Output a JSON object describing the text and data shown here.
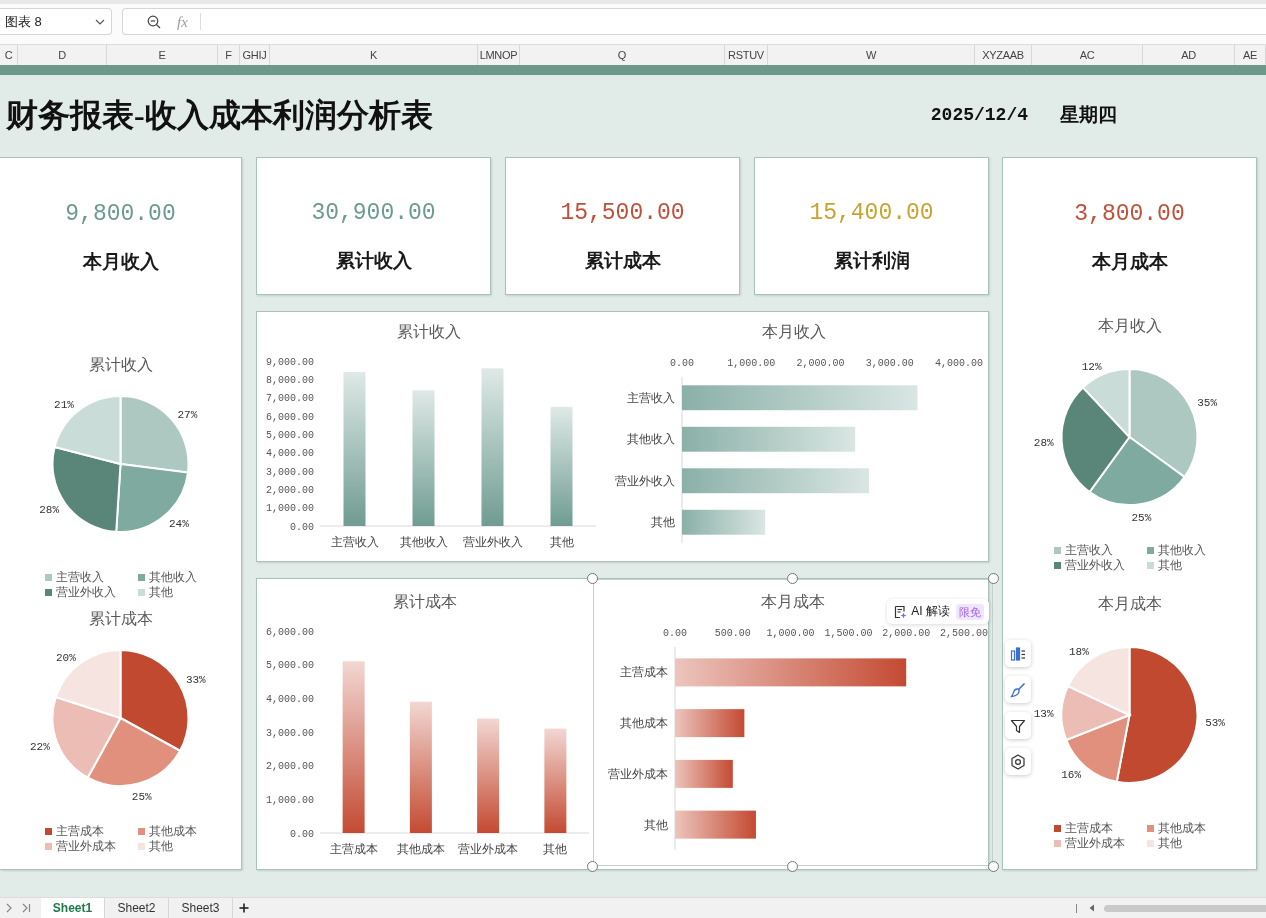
{
  "formula_bar": {
    "name_box": "图表 8",
    "function_label": "fx"
  },
  "column_headers": [
    "C",
    "D",
    "E",
    "F",
    "GHIJ",
    "K",
    "LMNOP",
    "Q",
    "RSTUV",
    "W",
    "XYZAAB",
    "AC",
    "AD",
    "AE"
  ],
  "header": {
    "title": "财务报表-收入成本利润分析表",
    "date": "2025/12/4",
    "weekday": "星期四"
  },
  "left_panel": {
    "kpi": {
      "value": "9,800.00",
      "label": "本月收入",
      "color": "#6b9a8e"
    },
    "charts": [
      {
        "selected": false,
        "chart_data": {
          "type": "pie",
          "title": "累计收入",
          "categories": [
            "主营收入",
            "其他收入",
            "营业外收入",
            "其他"
          ],
          "values": [
            27,
            24,
            28,
            21
          ],
          "colors": [
            "#adc8c1",
            "#7faa9f",
            "#5a8679",
            "#c9dcd7"
          ],
          "data_labels": true,
          "value_labels": [
            "27%",
            "24%",
            "28%",
            "21%"
          ],
          "legend": "bottom"
        }
      },
      {
        "selected": false,
        "chart_data": {
          "type": "pie",
          "title": "累计成本",
          "categories": [
            "主营成本",
            "其他成本",
            "营业外成本",
            "其他"
          ],
          "values": [
            33,
            25,
            22,
            20
          ],
          "colors": [
            "#c0492f",
            "#e0907c",
            "#ecbdb5",
            "#f6e4e1"
          ],
          "data_labels": true,
          "value_labels": [
            "33%",
            "25%",
            "22%",
            "20%"
          ],
          "legend": "bottom"
        }
      }
    ]
  },
  "kpi_cards": [
    {
      "value": "30,900.00",
      "label": "累计收入",
      "color": "#6b9a8e"
    },
    {
      "value": "15,500.00",
      "label": "累计成本",
      "color": "#c0503a"
    },
    {
      "value": "15,400.00",
      "label": "累计利润",
      "color": "#c9a330"
    }
  ],
  "chart_panels": [
    {
      "charts": [
        {
          "selected": false,
          "chart_data": {
            "type": "bar",
            "title": "累计收入",
            "categories": [
              "主营收入",
              "其他收入",
              "营业外收入",
              "其他"
            ],
            "values": [
              8400,
              7400,
              8600,
              6500
            ],
            "color": "#6f9c91",
            "ylim": [
              0,
              9000
            ],
            "yticks": [
              {
                "value": 0,
                "label": "0.00"
              },
              {
                "value": 1000,
                "label": "1,000.00"
              },
              {
                "value": 2000,
                "label": "2,000.00"
              },
              {
                "value": 3000,
                "label": "3,000.00"
              },
              {
                "value": 4000,
                "label": "4,000.00"
              },
              {
                "value": 5000,
                "label": "5,000.00"
              },
              {
                "value": 6000,
                "label": "6,000.00"
              },
              {
                "value": 7000,
                "label": "7,000.00"
              },
              {
                "value": 8000,
                "label": "8,000.00"
              },
              {
                "value": 9000,
                "label": "9,000.00"
              }
            ]
          }
        },
        {
          "selected": false,
          "chart_data": {
            "type": "bar",
            "orientation": "horizontal",
            "title": "本月收入",
            "categories": [
              "主营收入",
              "其他收入",
              "营业外收入",
              "其他"
            ],
            "values": [
              3400,
              2500,
              2700,
              1200
            ],
            "color": "#8ab0a7",
            "xlim": [
              0,
              4000
            ],
            "xticks": [
              {
                "value": 0,
                "label": "0.00"
              },
              {
                "value": 1000,
                "label": "1,000.00"
              },
              {
                "value": 2000,
                "label": "2,000.00"
              },
              {
                "value": 3000,
                "label": "3,000.00"
              },
              {
                "value": 4000,
                "label": "4,000.00"
              }
            ]
          }
        }
      ]
    },
    {
      "charts": [
        {
          "selected": false,
          "chart_data": {
            "type": "bar",
            "title": "累计成本",
            "categories": [
              "主营成本",
              "其他成本",
              "营业外成本",
              "其他"
            ],
            "values": [
              5100,
              3900,
              3400,
              3100
            ],
            "color": "#c44a32",
            "ylim": [
              0,
              6000
            ],
            "yticks": [
              {
                "value": 0,
                "label": "0.00"
              },
              {
                "value": 1000,
                "label": "1,000.00"
              },
              {
                "value": 2000,
                "label": "2,000.00"
              },
              {
                "value": 3000,
                "label": "3,000.00"
              },
              {
                "value": 4000,
                "label": "4,000.00"
              },
              {
                "value": 5000,
                "label": "5,000.00"
              },
              {
                "value": 6000,
                "label": "6,000.00"
              }
            ]
          }
        },
        {
          "selected": true,
          "chart_data": {
            "type": "bar",
            "orientation": "horizontal",
            "title": "本月成本",
            "categories": [
              "主营成本",
              "其他成本",
              "营业外成本",
              "其他"
            ],
            "values": [
              2000,
              600,
              500,
              700
            ],
            "color": "#c44a32",
            "xlim": [
              0,
              2500
            ],
            "xticks": [
              {
                "value": 0,
                "label": "0.00"
              },
              {
                "value": 500,
                "label": "500.00"
              },
              {
                "value": 1000,
                "label": "1,000.00"
              },
              {
                "value": 1500,
                "label": "1,500.00"
              },
              {
                "value": 2000,
                "label": "2,000.00"
              },
              {
                "value": 2500,
                "label": "2,500.00"
              }
            ]
          }
        }
      ]
    }
  ],
  "right_panel": {
    "kpi": {
      "value": "3,800.00",
      "label": "本月成本",
      "color": "#c0503a"
    },
    "charts": [
      {
        "selected": false,
        "chart_data": {
          "type": "pie",
          "title": "本月收入",
          "categories": [
            "主营收入",
            "其他收入",
            "营业外收入",
            "其他"
          ],
          "values": [
            35,
            25,
            28,
            12
          ],
          "colors": [
            "#adc8c1",
            "#7faa9f",
            "#5a8679",
            "#c9dcd7"
          ],
          "data_labels": true,
          "value_labels": [
            "35%",
            "25%",
            "28%",
            "12%"
          ],
          "legend": "bottom"
        }
      },
      {
        "selected": false,
        "chart_data": {
          "type": "pie",
          "title": "本月成本",
          "categories": [
            "主营成本",
            "其他成本",
            "营业外成本",
            "其他"
          ],
          "values": [
            53,
            16,
            13,
            18
          ],
          "colors": [
            "#c0492f",
            "#e0907c",
            "#ecbdb5",
            "#f6e4e1"
          ],
          "data_labels": true,
          "value_labels": [
            "53%",
            "16%",
            "13%",
            "18%"
          ],
          "legend": "bottom"
        }
      }
    ]
  },
  "ai_button": {
    "label": "AI 解读",
    "badge": "限免"
  },
  "sheet_tabs": [
    {
      "label": "Sheet1",
      "selected": true
    },
    {
      "label": "Sheet2",
      "selected": false
    },
    {
      "label": "Sheet3",
      "selected": false
    }
  ]
}
